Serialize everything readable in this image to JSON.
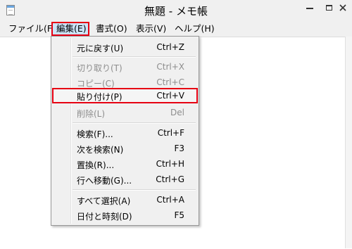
{
  "window": {
    "title": "無題 - メモ帳"
  },
  "menubar": {
    "items": [
      "ファイル(F)",
      "編集(E)",
      "書式(O)",
      "表示(V)",
      "ヘルプ(H)"
    ]
  },
  "edit_menu": {
    "items": [
      {
        "label": "元に戻す(U)",
        "shortcut": "Ctrl+Z",
        "enabled": true
      },
      {
        "label": "切り取り(T)",
        "shortcut": "Ctrl+X",
        "enabled": false
      },
      {
        "label": "コピー(C)",
        "shortcut": "Ctrl+C",
        "enabled": false
      },
      {
        "label": "貼り付け(P)",
        "shortcut": "Ctrl+V",
        "enabled": true,
        "highlighted": true
      },
      {
        "label": "削除(L)",
        "shortcut": "Del",
        "enabled": false
      },
      {
        "label": "検索(F)...",
        "shortcut": "Ctrl+F",
        "enabled": true
      },
      {
        "label": "次を検索(N)",
        "shortcut": "F3",
        "enabled": true
      },
      {
        "label": "置換(R)...",
        "shortcut": "Ctrl+H",
        "enabled": true
      },
      {
        "label": "行へ移動(G)...",
        "shortcut": "Ctrl+G",
        "enabled": true
      },
      {
        "label": "すべて選択(A)",
        "shortcut": "Ctrl+A",
        "enabled": true
      },
      {
        "label": "日付と時刻(D)",
        "shortcut": "F5",
        "enabled": true
      }
    ]
  },
  "colors": {
    "highlight_border": "#e60012",
    "menu_active_bg": "#cce4f7",
    "disabled_text": "#8d8d8d"
  }
}
